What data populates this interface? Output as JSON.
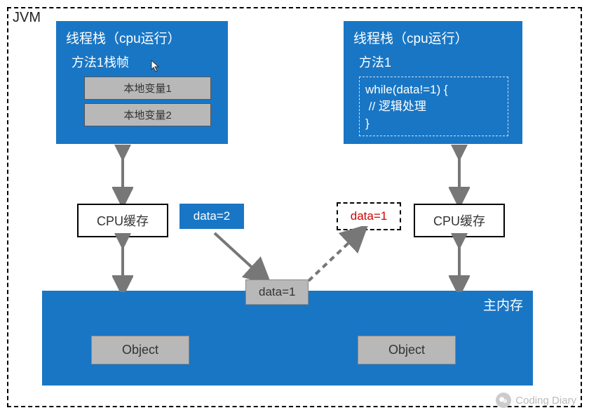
{
  "jvm_label": "JVM",
  "left_stack": {
    "title": "线程栈（cpu运行）",
    "frame": "方法1栈帧",
    "var1": "本地变量1",
    "var2": "本地变量2"
  },
  "right_stack": {
    "title": "线程栈（cpu运行）",
    "frame": "方法1",
    "code": "while(data!=1) {\n // 逻辑处理\n}"
  },
  "cache_left": "CPU缓存",
  "cache_right": "CPU缓存",
  "data_blue": "data=2",
  "data_dashed": "data=1",
  "data_heap": "data=1",
  "mem_label": "主内存",
  "object_left": "Object",
  "object_right": "Object",
  "watermark": "Coding Diary"
}
